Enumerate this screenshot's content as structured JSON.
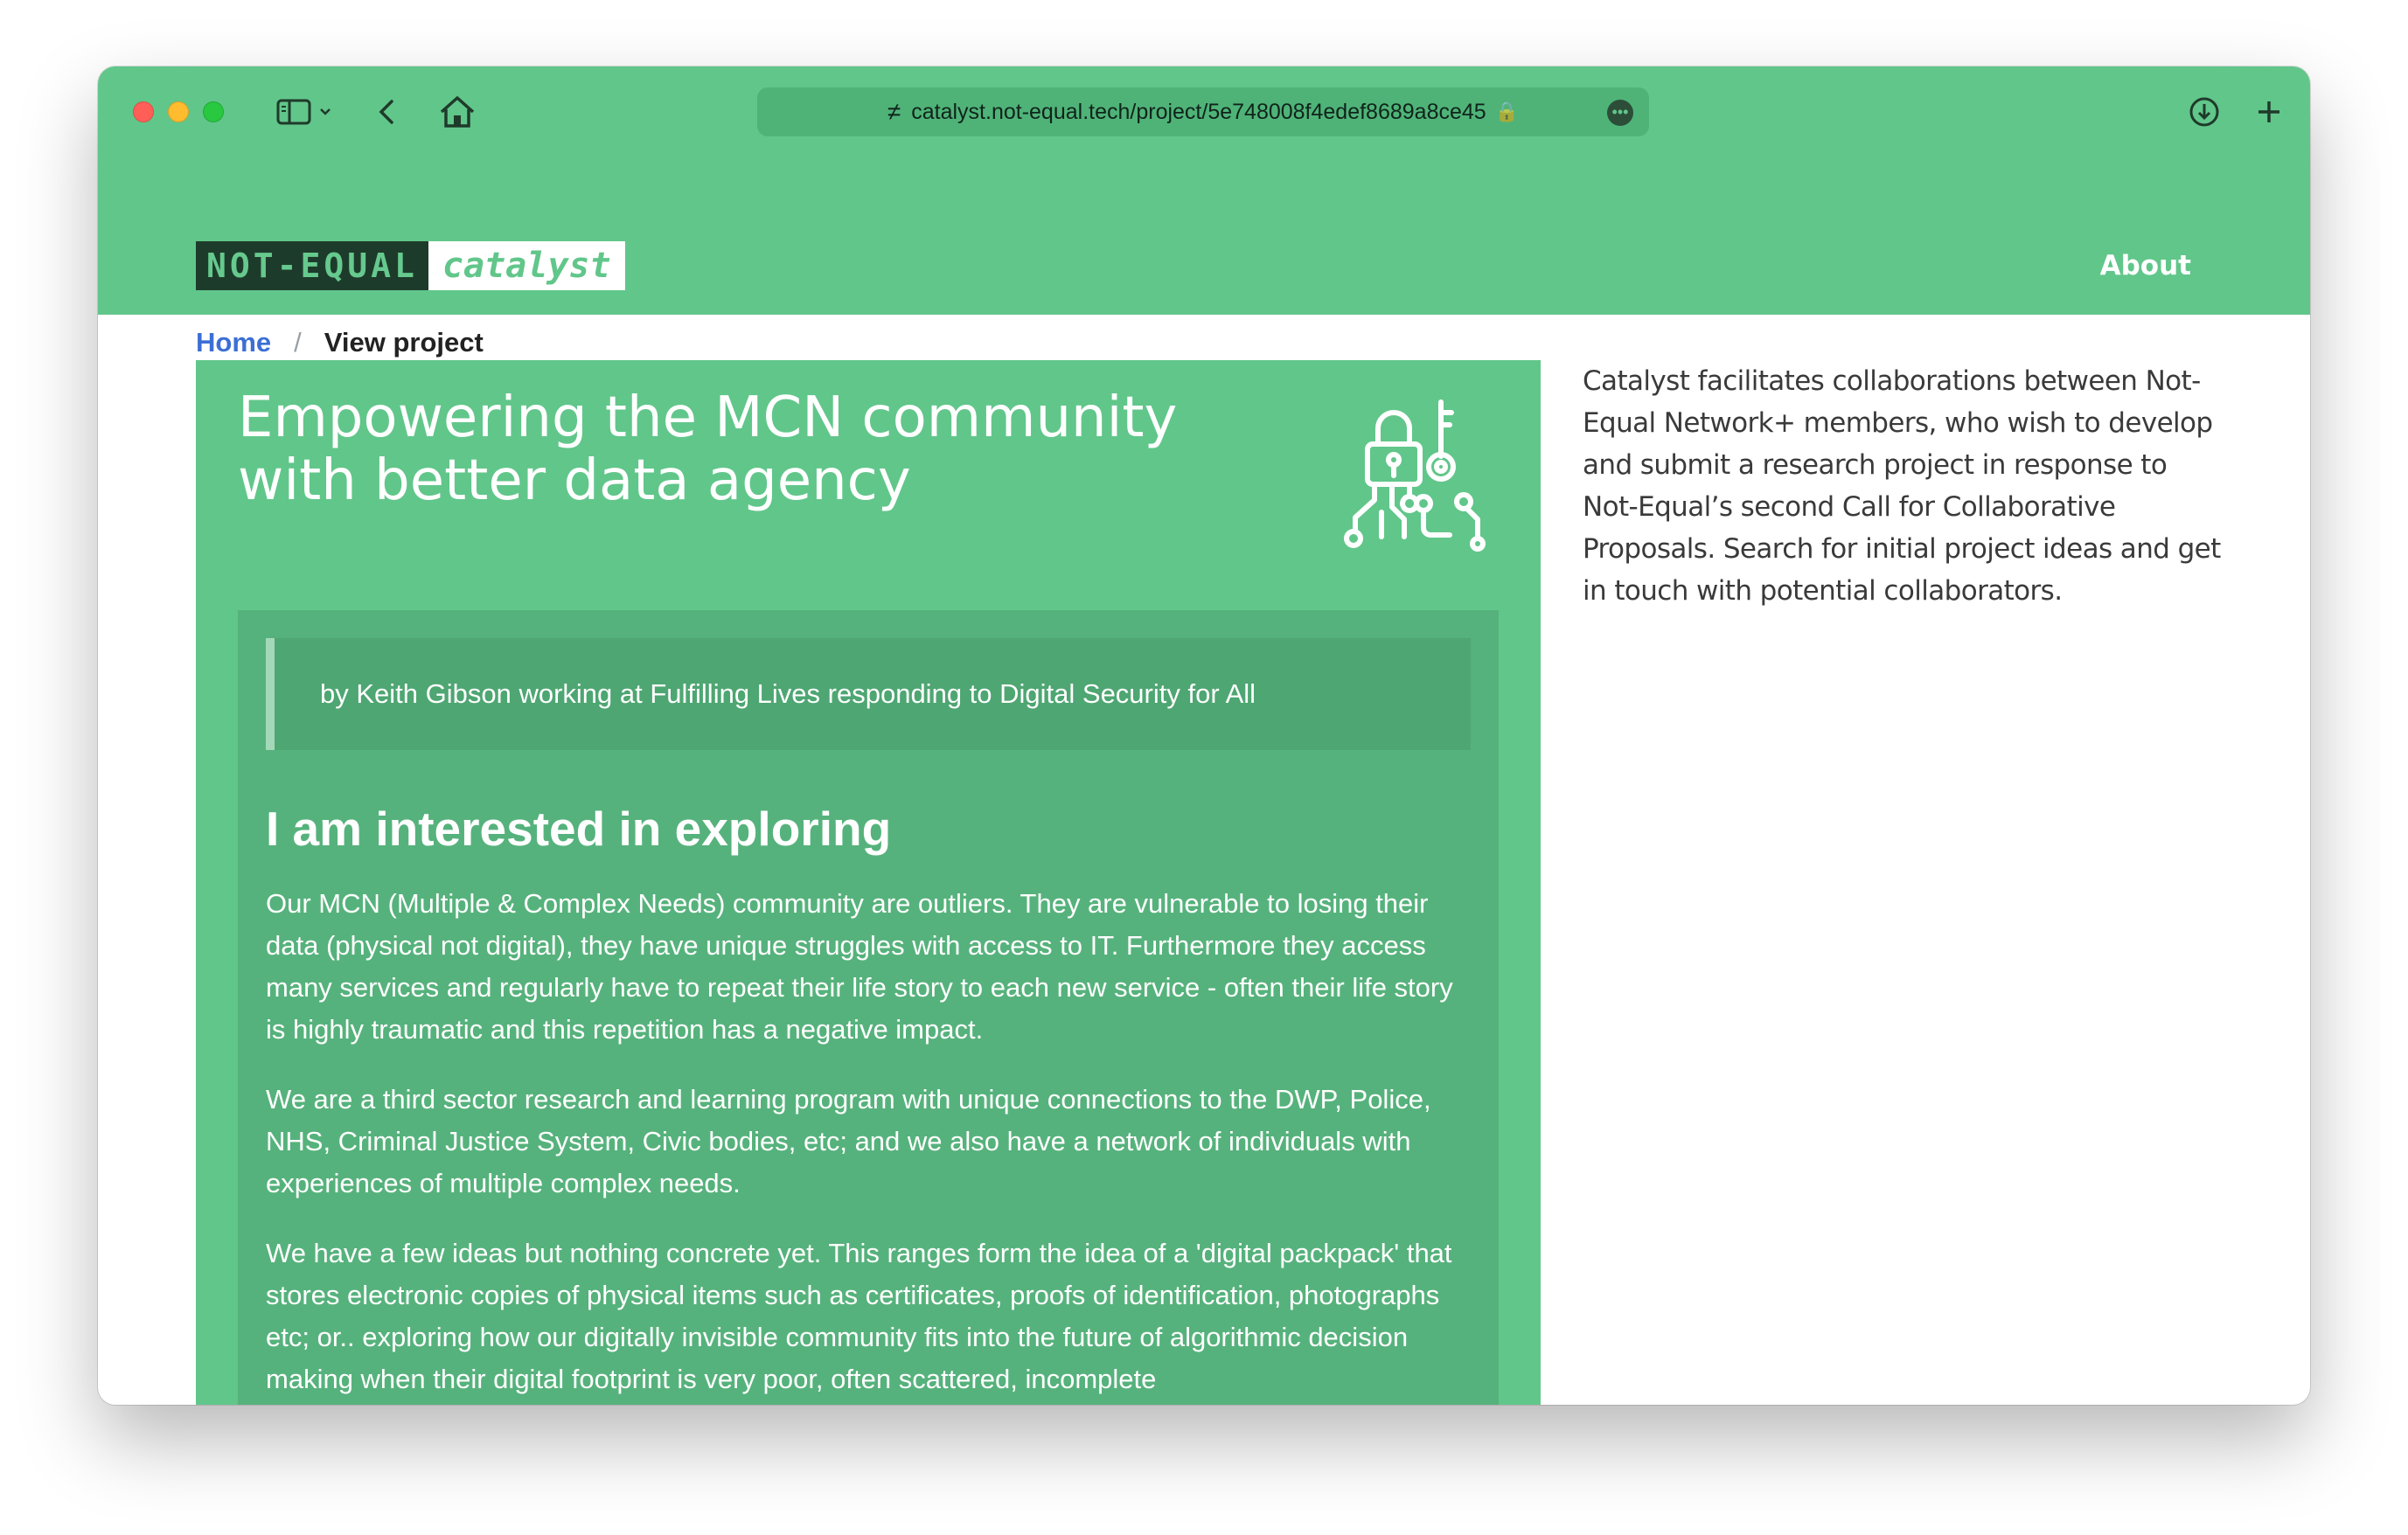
{
  "browser": {
    "url": "catalyst.not-equal.tech/project/5e748008f4edef8689a8ce45"
  },
  "site": {
    "logo_left": "NOT-EQUAL",
    "logo_right": "catalyst",
    "nav_about": "About"
  },
  "breadcrumb": {
    "home": "Home",
    "separator": "/",
    "current": "View project"
  },
  "project": {
    "title": "Empowering the MCN community with better data agency",
    "byline": "by Keith Gibson working at Fulfilling Lives responding to Digital Security for All",
    "section_title": "I am interested in exploring",
    "paragraphs": [
      "Our MCN (Multiple & Complex Needs) community are outliers. They are vulnerable to losing their data (physical not digital), they have unique struggles with access to IT. Furthermore they access many services and regularly have to repeat their life story to each new service - often their life story is highly traumatic and this repetition has a negative impact.",
      "We are a third sector research and learning program with unique connections to the DWP, Police, NHS, Criminal Justice System, Civic bodies, etc; and we also have a network of individuals with experiences of multiple complex needs.",
      "We have a few ideas but nothing concrete yet. This ranges form the idea of a 'digital packpack' that stores electronic copies of physical items such as certificates, proofs of identification, photographs etc; or.. exploring how our digitally invisible community fits into the future of algorithmic decision making when their digital footprint is very poor, often scattered, incomplete"
    ]
  },
  "sidebar": {
    "text": "Catalyst facilitates collaborations between Not-Equal Network+ members, who wish to develop and submit a research project in response to Not-Equal’s second Call for Collaborative Proposals. Search for initial project ideas and get in touch with potential collaborators."
  },
  "icons": {
    "sidebar_toggle": "sidebar-icon",
    "back": "chevron-left-icon",
    "home": "home-icon",
    "download": "download-icon",
    "new_tab": "plus-icon",
    "card": "lock-key-circuit-icon"
  }
}
